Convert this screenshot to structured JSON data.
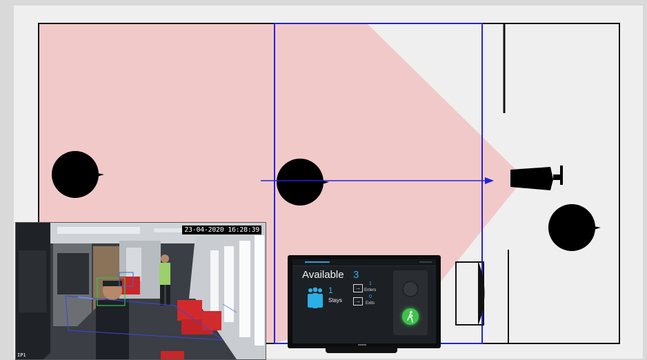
{
  "cctv": {
    "timestamp": "23-04-2020 16:28:39",
    "corner_label": "IP1"
  },
  "display": {
    "status_label": "Available",
    "status_count": "3",
    "stays_count": "1",
    "stays_label": "Stays",
    "enters_count": "1",
    "enters_label": "Enters",
    "exits_count": "0",
    "exits_label": "Exits"
  },
  "colors": {
    "coverage_zone": "#f2c9c9",
    "detection_line": "#2222dd",
    "accent": "#2ab0e6",
    "go_light": "#3ec24a"
  }
}
